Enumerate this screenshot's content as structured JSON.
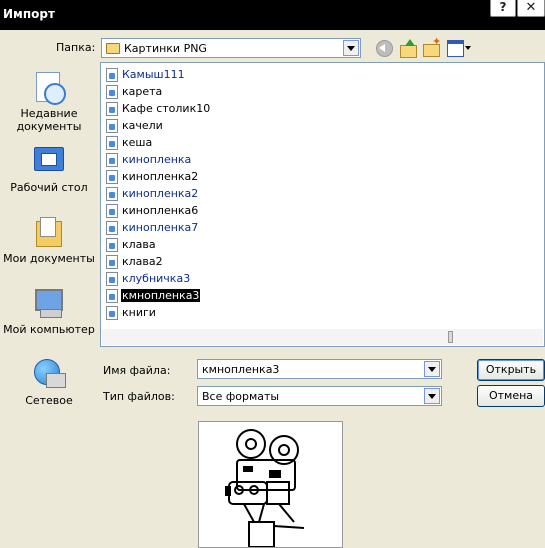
{
  "window": {
    "title": "Импорт",
    "help_button": "?",
    "close_button": "✕"
  },
  "toolbar": {
    "folder_label": "Папка:",
    "folder_value": "Картинки PNG",
    "icons": [
      "back-icon",
      "up-folder-icon",
      "new-folder-icon",
      "view-menu-icon"
    ]
  },
  "places": [
    {
      "label": "Недавние документы",
      "icon": "recent-documents-icon"
    },
    {
      "label": "Рабочий стол",
      "icon": "desktop-icon"
    },
    {
      "label": "Мои документы",
      "icon": "my-documents-icon"
    },
    {
      "label": "Мой компьютер",
      "icon": "my-computer-icon"
    },
    {
      "label": "Сетевое",
      "icon": "network-icon"
    }
  ],
  "files": [
    {
      "name": "Камыш111",
      "blue": true
    },
    {
      "name": "карета",
      "blue": false
    },
    {
      "name": "Кафе столик10",
      "blue": false
    },
    {
      "name": "качели",
      "blue": false
    },
    {
      "name": "кеша",
      "blue": false
    },
    {
      "name": "кинопленка",
      "blue": true
    },
    {
      "name": "кинопленка2",
      "blue": false
    },
    {
      "name": "кинопленка2",
      "blue": true
    },
    {
      "name": "кинопленка6",
      "blue": false
    },
    {
      "name": "кинопленка7",
      "blue": true
    },
    {
      "name": "клава",
      "blue": false
    },
    {
      "name": "клава2",
      "blue": false
    },
    {
      "name": "клубничка3",
      "blue": true
    },
    {
      "name": "кмнопленка3",
      "blue": false,
      "selected": true
    },
    {
      "name": "книги",
      "blue": false
    }
  ],
  "form": {
    "filename_label": "Имя файла:",
    "filename_value": "кмнопленка3",
    "filetype_label": "Тип файлов:",
    "filetype_value": "Все форматы"
  },
  "buttons": {
    "open": "Открыть",
    "cancel": "Отмена"
  },
  "colors": {
    "titlebar": "#000000",
    "dialog_bg": "#ece9d8",
    "selection": "#000000",
    "blue_text": "#0c2d8c"
  }
}
